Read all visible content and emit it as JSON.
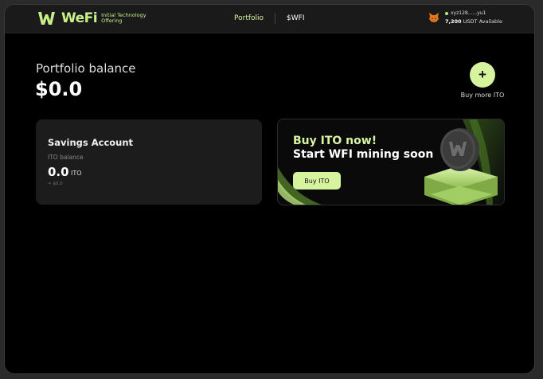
{
  "header": {
    "logo_word": "WeFi",
    "logo_sub_line1": "Initial Technology",
    "logo_sub_line2": "Offering",
    "nav": [
      {
        "label": "Portfolio",
        "active": true
      },
      {
        "label": "$WFI",
        "active": false
      }
    ],
    "wallet": {
      "address": "xyz128......yu1",
      "balance_amount": "7,200",
      "balance_suffix": "USDT Available",
      "icon": "metamask-fox-icon"
    }
  },
  "portfolio": {
    "label": "Portfolio balance",
    "value": "$0.0"
  },
  "buy_more": {
    "icon": "plus-icon",
    "label": "Buy more ITO"
  },
  "savings": {
    "title": "Savings Account",
    "balance_label": "ITO balance",
    "amount": "0.0",
    "unit": "ITO",
    "approx": "≈ $0.0"
  },
  "promo": {
    "headline": "Buy ITO now!",
    "subheadline": "Start WFI mining soon",
    "button_label": "Buy ITO"
  },
  "colors": {
    "accent": "#d6f39e",
    "background": "#000000",
    "card": "#1c1c1c",
    "topbar": "#1a1a1a"
  }
}
